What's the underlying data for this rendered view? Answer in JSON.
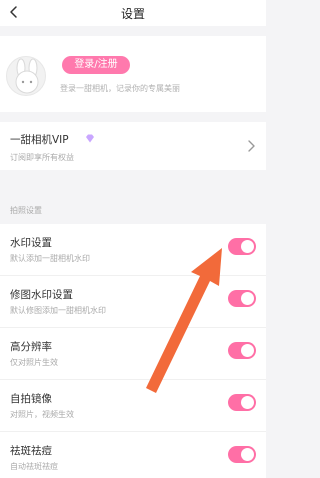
{
  "header": {
    "title": "设置"
  },
  "profile": {
    "login_button": "登录/注册",
    "subtitle": "登录一甜相机，记录你的专属美丽"
  },
  "vip": {
    "title": "一甜相机VIP",
    "subtitle": "订阅即享所有权益"
  },
  "section": {
    "label": "拍照设置"
  },
  "settings": [
    {
      "title": "水印设置",
      "subtitle": "默认添加一甜相机水印",
      "enabled": true
    },
    {
      "title": "修图水印设置",
      "subtitle": "默认修图添加一甜相机水印",
      "enabled": true
    },
    {
      "title": "高分辨率",
      "subtitle": "仅对照片生效",
      "enabled": true
    },
    {
      "title": "自拍镜像",
      "subtitle": "对照片，视频生效",
      "enabled": true
    },
    {
      "title": "祛斑祛痘",
      "subtitle": "自动祛斑祛痘",
      "enabled": true
    }
  ],
  "colors": {
    "accent": "#ff6fa6",
    "arrow": "#f26a3a"
  },
  "icons": {
    "back": "back-arrow-icon",
    "vip": "diamond-icon",
    "chevron": "chevron-right-icon",
    "avatar": "bunny-avatar-icon"
  }
}
